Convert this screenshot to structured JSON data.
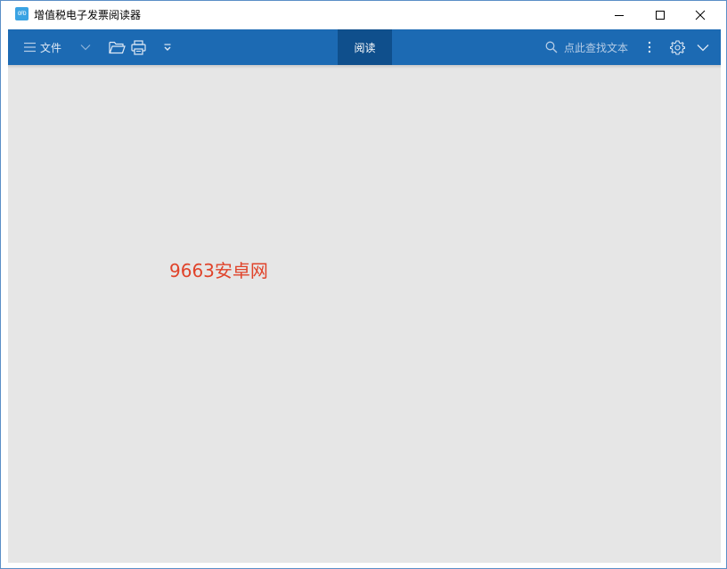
{
  "window": {
    "title": "增值税电子发票阅读器",
    "app_icon_text": "OFD"
  },
  "toolbar": {
    "menu_label": "文件",
    "tab_read_label": "阅读",
    "search_placeholder": "点此查找文本"
  },
  "content": {
    "watermark_text": "9663安卓网"
  },
  "colors": {
    "toolbar_bg": "#1c6ab3",
    "active_tab_bg": "#0f4f8c",
    "content_bg": "#e6e6e6",
    "watermark": "#e0432a"
  },
  "icons": {
    "app": "ofd-app-icon",
    "minimize": "minimize-icon",
    "maximize": "maximize-icon",
    "close": "close-icon",
    "menu": "hamburger-icon",
    "dropdown": "chevron-down-icon",
    "open": "folder-open-icon",
    "print": "printer-icon",
    "more": "more-vertical-icon",
    "settings": "gear-icon",
    "collapse": "chevron-down-icon"
  }
}
